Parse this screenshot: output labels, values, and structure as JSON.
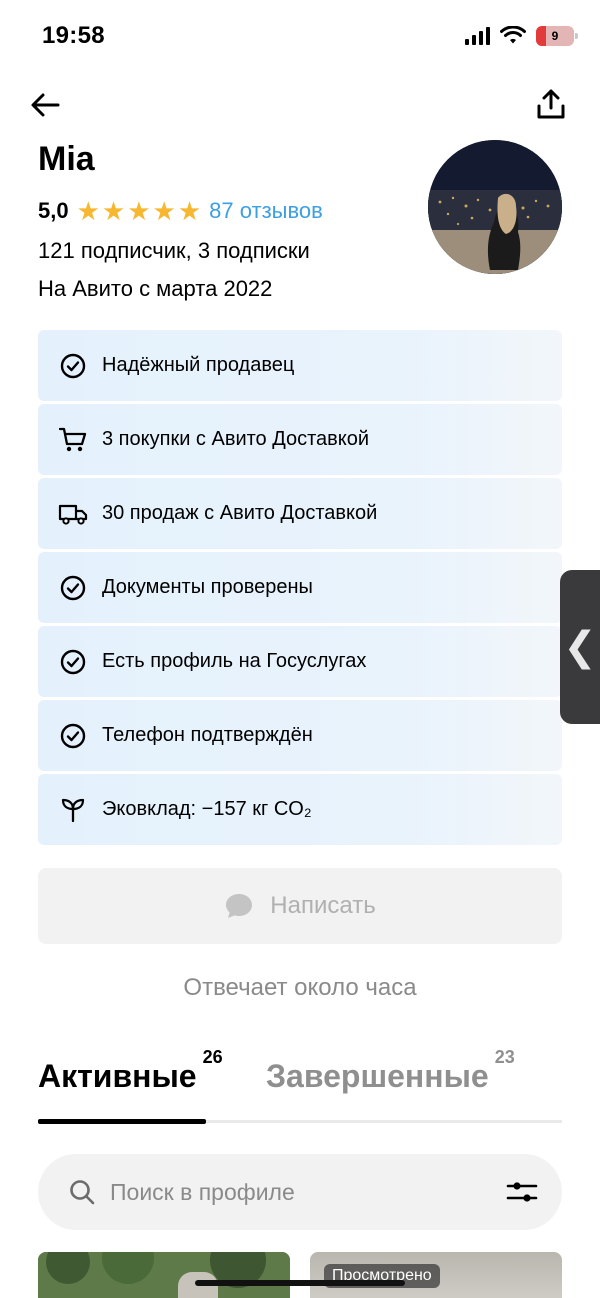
{
  "status_bar": {
    "time": "19:58",
    "battery_level": "9",
    "icons": [
      "signal-icon",
      "wifi-icon",
      "battery-icon"
    ]
  },
  "nav": {
    "back_icon": "arrow-left-icon",
    "share_icon": "share-icon"
  },
  "profile": {
    "name": "Mia",
    "rating": "5,0",
    "stars": 5,
    "reviews_link": "87 отзывов",
    "followers": "121 подписчик, 3 подписки",
    "since": "На Авито с марта 2022"
  },
  "badges": [
    {
      "icon": "check-circle-icon",
      "label": "Надёжный продавец"
    },
    {
      "icon": "cart-icon",
      "label": "3 покупки с Авито Доставкой"
    },
    {
      "icon": "truck-icon",
      "label": "30 продаж с Авито Доставкой"
    },
    {
      "icon": "check-circle-icon",
      "label": "Документы проверены"
    },
    {
      "icon": "check-circle-icon",
      "label": "Есть профиль на Госуслугах"
    },
    {
      "icon": "check-circle-icon",
      "label": "Телефон подтверждён"
    },
    {
      "icon": "sprout-icon",
      "label": "Эковклад: −157 кг CO₂"
    }
  ],
  "message_button": {
    "label": "Написать",
    "icon": "chat-bubble-icon"
  },
  "answer_time": "Отвечает около часа",
  "tabs": [
    {
      "label": "Активные",
      "count": "26",
      "active": true
    },
    {
      "label": "Завершенные",
      "count": "23",
      "active": false
    }
  ],
  "search": {
    "placeholder": "Поиск в профиле"
  },
  "items": [
    {
      "badge": ""
    },
    {
      "badge": "Просмотрено"
    }
  ],
  "colors": {
    "accent_link": "#3c9fe0",
    "star": "#f7b731",
    "badge_bg": "#e4f1fc"
  }
}
